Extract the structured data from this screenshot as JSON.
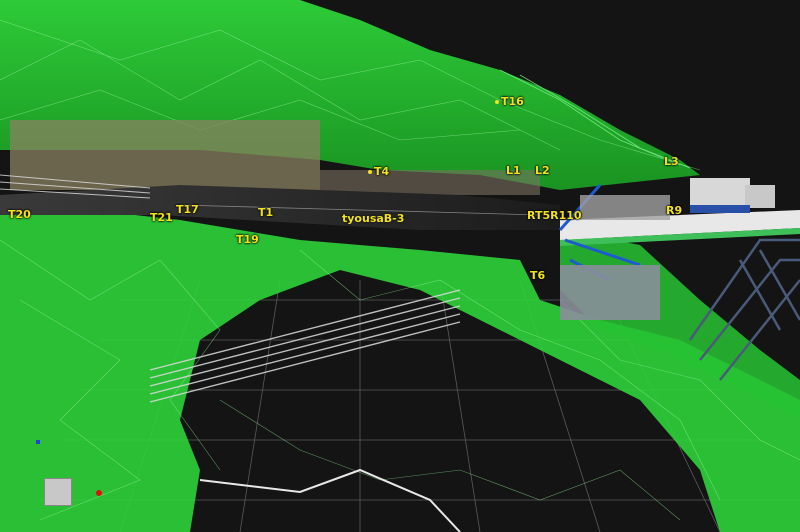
{
  "markers": [
    {
      "id": "T16",
      "label": "T16"
    },
    {
      "id": "T4",
      "label": "T4"
    },
    {
      "id": "L1",
      "label": "L1"
    },
    {
      "id": "L2",
      "label": "L2"
    },
    {
      "id": "L3",
      "label": "L3"
    },
    {
      "id": "T17",
      "label": "T17"
    },
    {
      "id": "T21",
      "label": "T21"
    },
    {
      "id": "T1",
      "label": "T1"
    },
    {
      "id": "T19",
      "label": "T19"
    },
    {
      "id": "RT5R110",
      "label": "RT5R110"
    },
    {
      "id": "R9",
      "label": "R9"
    },
    {
      "id": "T6",
      "label": "T6"
    },
    {
      "id": "T20",
      "label": "T20"
    }
  ],
  "road_label": "tyousaB-3",
  "colors": {
    "mesh": "#3fe84a",
    "mesh_dark": "#1fa82a",
    "marker": "#f2e21a",
    "grid": "#6a6a6a",
    "background": "#121212",
    "bridge": "#3fa8c8"
  },
  "icons": {
    "view_cube": "view-cube-icon",
    "axis_x": "axis-x-indicator",
    "axis_y": "axis-y-indicator"
  }
}
